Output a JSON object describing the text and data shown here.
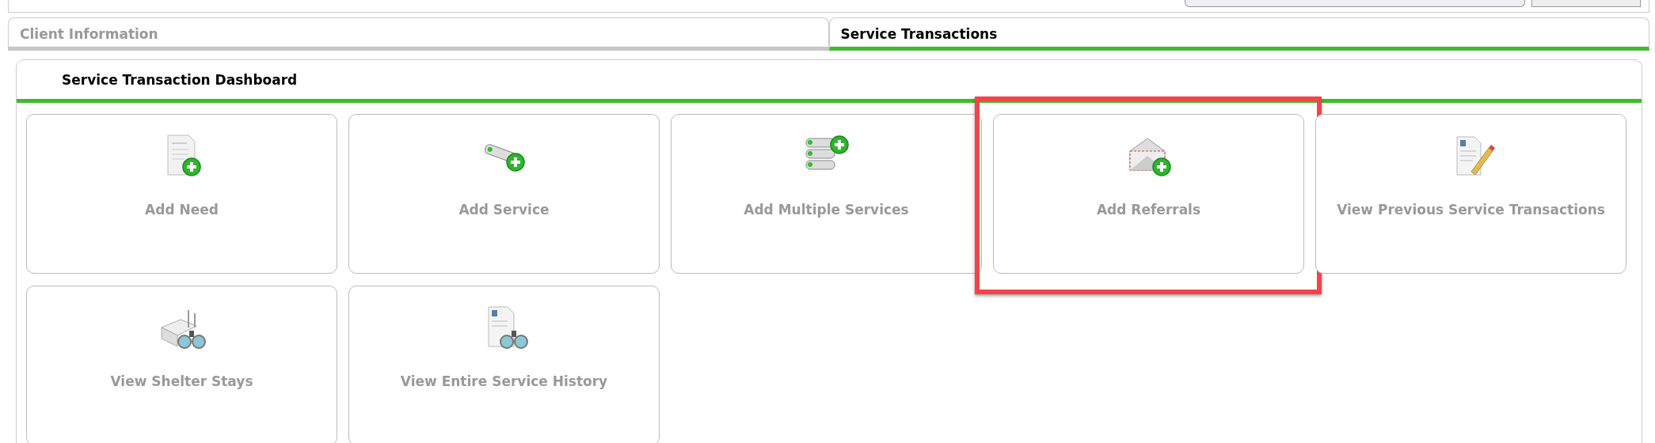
{
  "tabs": [
    {
      "label": "Client Information",
      "selected": false
    },
    {
      "label": "Service Transactions",
      "selected": true
    }
  ],
  "dashboard": {
    "title": "Service Transaction Dashboard",
    "tiles": [
      {
        "label": "Add Need",
        "highlighted": false
      },
      {
        "label": "Add Service",
        "highlighted": false
      },
      {
        "label": "Add Multiple Services",
        "highlighted": false
      },
      {
        "label": "Add Referrals",
        "highlighted": true
      },
      {
        "label": "View Previous Service Transactions",
        "highlighted": false
      },
      {
        "label": "View Shelter Stays",
        "highlighted": false
      },
      {
        "label": "View Entire Service History",
        "highlighted": false
      }
    ]
  }
}
